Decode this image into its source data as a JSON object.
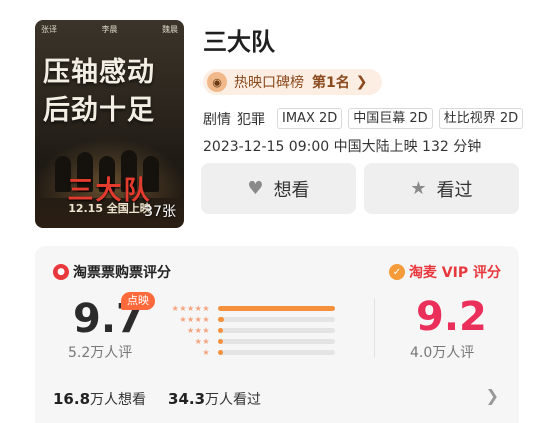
{
  "movie": {
    "title": "三大队",
    "poster": {
      "cast": [
        "张译",
        "李晨",
        "魏晨"
      ],
      "headline_line1": "压轴感动",
      "headline_line2": "后劲十足",
      "logo_text": "三大队",
      "release_text": "12.15 全国上映",
      "image_count": "37张"
    },
    "rank": {
      "label": "热映口碑榜",
      "value": "第1名",
      "icon": "ranking-face-icon"
    },
    "genres": [
      "剧情",
      "犯罪"
    ],
    "formats": [
      "IMAX 2D",
      "中国巨幕 2D",
      "杜比视界 2D"
    ],
    "release_line": "2023-12-15 09:00 中国大陆上映 132 分钟"
  },
  "actions": {
    "want": {
      "label": "想看",
      "icon": "heart-icon"
    },
    "seen": {
      "label": "看过",
      "icon": "star-icon"
    }
  },
  "ratings": {
    "left": {
      "source": "淘票票购票评分",
      "score": "9.7",
      "hot_tag": "点映",
      "votes": "5.2万人评",
      "distribution": [
        {
          "stars": "★★★★★",
          "fraction": 1.0
        },
        {
          "stars": "★★★★",
          "fraction": 0.05
        },
        {
          "stars": "★★★",
          "fraction": 0.03
        },
        {
          "stars": "★★",
          "fraction": 0.02
        },
        {
          "stars": "★",
          "fraction": 0.02
        }
      ]
    },
    "right": {
      "source": "淘麦 VIP 评分",
      "score": "9.2",
      "votes": "4.0万人评"
    }
  },
  "stats": {
    "want_count": "16.8",
    "want_suffix": "万人想看",
    "seen_count": "34.3",
    "seen_suffix": "万人看过"
  },
  "colors": {
    "score_right": "#ea2f5b",
    "bar_fill": "#f5913c",
    "rank_bg": "#fdeee4"
  }
}
